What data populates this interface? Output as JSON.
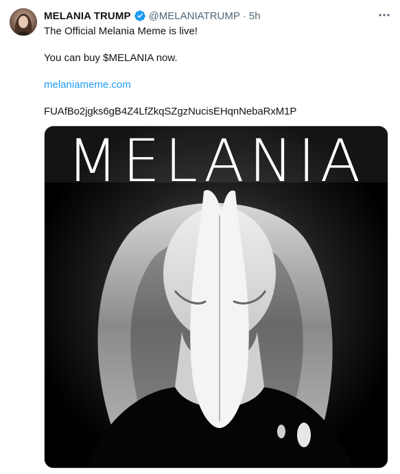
{
  "author": {
    "name": "MELANIA TRUMP",
    "handle": "@MELANIATRUMP",
    "separator": "·",
    "time": "5h",
    "verified_icon": "verified-badge-icon",
    "verified_color": "#1d9bf0"
  },
  "tweet": {
    "line1": "The Official Melania Meme is live!",
    "line2": "You can buy $MELANIA now.",
    "link": "melaniameme.com",
    "contract_address": "FUAfBo2jgks6gB4Z4LfZkqSZgzNucisEHqnNebaRxM1P"
  },
  "media": {
    "title": "MELANIA",
    "description": "black-and-white portrait photo"
  },
  "menu": {
    "more_icon": "more-options-icon"
  },
  "colors": {
    "text": "#0f1419",
    "muted": "#536471",
    "link": "#1d9bf0"
  }
}
